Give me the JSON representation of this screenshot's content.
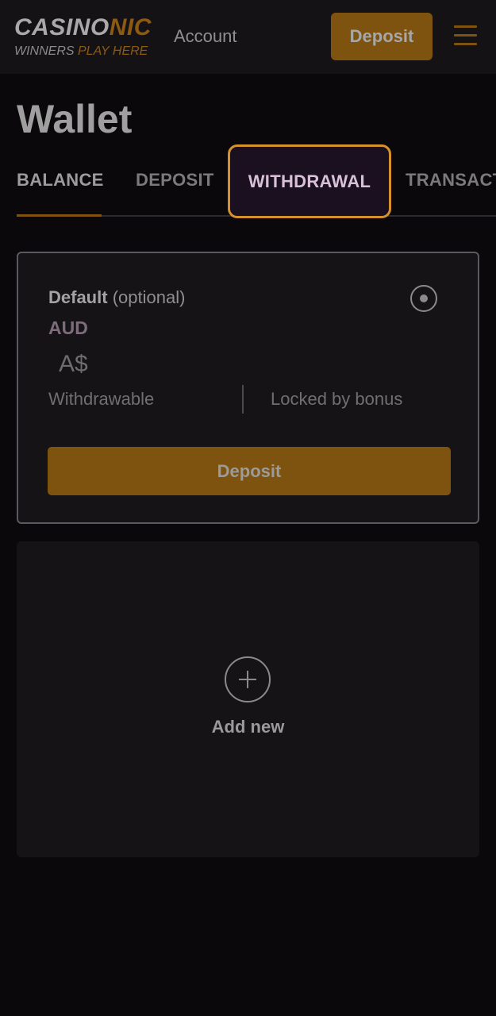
{
  "header": {
    "logo_main_a": "CASINO",
    "logo_main_b": "NIC",
    "logo_tag_a": "WINNERS ",
    "logo_tag_b": "PLAY HERE",
    "nav_account": "Account",
    "deposit_label": "Deposit",
    "menu_icon": "hamburger-menu-icon"
  },
  "page": {
    "title": "Wallet"
  },
  "tabs": [
    {
      "label": "BALANCE",
      "active": true
    },
    {
      "label": "DEPOSIT",
      "active": false
    },
    {
      "label": "WITHDRAWAL",
      "active": false,
      "highlighted": true
    },
    {
      "label": "TRANSACTIONS",
      "active": false
    }
  ],
  "wallet_card": {
    "name": "Default",
    "name_suffix": "(optional)",
    "currency": "AUD",
    "amount": "A$",
    "withdrawable_label": "Withdrawable",
    "locked_label": "Locked by bonus",
    "deposit_label": "Deposit",
    "radio_selected": true
  },
  "add_card": {
    "label": "Add new",
    "icon": "plus-circle-icon"
  },
  "colors": {
    "background": "#0b080b",
    "accent": "#7d530f",
    "highlight_border": "#d4912c"
  }
}
